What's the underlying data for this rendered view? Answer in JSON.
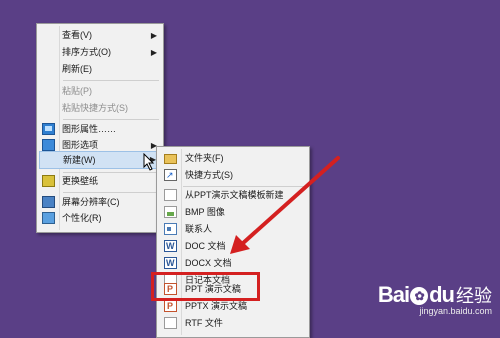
{
  "context_menu": {
    "items": [
      {
        "label": "查看(V)",
        "submenu": true,
        "disabled": false
      },
      {
        "label": "排序方式(O)",
        "submenu": true,
        "disabled": false
      },
      {
        "label": "刷新(E)",
        "submenu": false,
        "disabled": false
      },
      {
        "label": "粘贴(P)",
        "submenu": false,
        "disabled": true
      },
      {
        "label": "粘贴快捷方式(S)",
        "submenu": false,
        "disabled": true
      },
      {
        "label": "图形属性……",
        "icon": "graphics-properties-icon"
      },
      {
        "label": "图形选项",
        "icon": "graphics-options-icon",
        "submenu": true
      },
      {
        "label": "新建(W)",
        "submenu": true,
        "highlighted": true
      },
      {
        "label": "更换壁纸",
        "icon": "wallpaper-icon"
      },
      {
        "label": "屏幕分辨率(C)",
        "icon": "screen-resolution-icon"
      },
      {
        "label": "个性化(R)",
        "icon": "personalize-icon"
      }
    ]
  },
  "new_submenu": {
    "items": [
      {
        "label": "文件夹(F)",
        "icon": "folder-icon"
      },
      {
        "label": "快捷方式(S)",
        "icon": "shortcut-icon"
      },
      {
        "label": "从PPT演示文稿模板新建",
        "icon": "document-icon"
      },
      {
        "label": "BMP 图像",
        "icon": "bitmap-icon"
      },
      {
        "label": "联系人",
        "icon": "contact-icon"
      },
      {
        "label": "DOC 文档",
        "icon": "word-doc-icon"
      },
      {
        "label": "DOCX 文档",
        "icon": "word-docx-icon"
      },
      {
        "label": "日记本文档",
        "icon": "journal-icon"
      },
      {
        "label": "PPT 演示文稿",
        "icon": "ppt-icon"
      },
      {
        "label": "PPTX 演示文稿",
        "icon": "pptx-icon"
      },
      {
        "label": "RTF 文件",
        "icon": "rtf-icon"
      }
    ]
  },
  "watermark": {
    "brand_a": "Bai",
    "brand_b": "du",
    "brand_cn": "经验",
    "url": "jingyan.baidu.com"
  },
  "colors": {
    "desktop": "#5a3f86",
    "menu_bg": "#f1f1f1",
    "highlight": "#d1e2f4",
    "annotation": "#d42020"
  }
}
